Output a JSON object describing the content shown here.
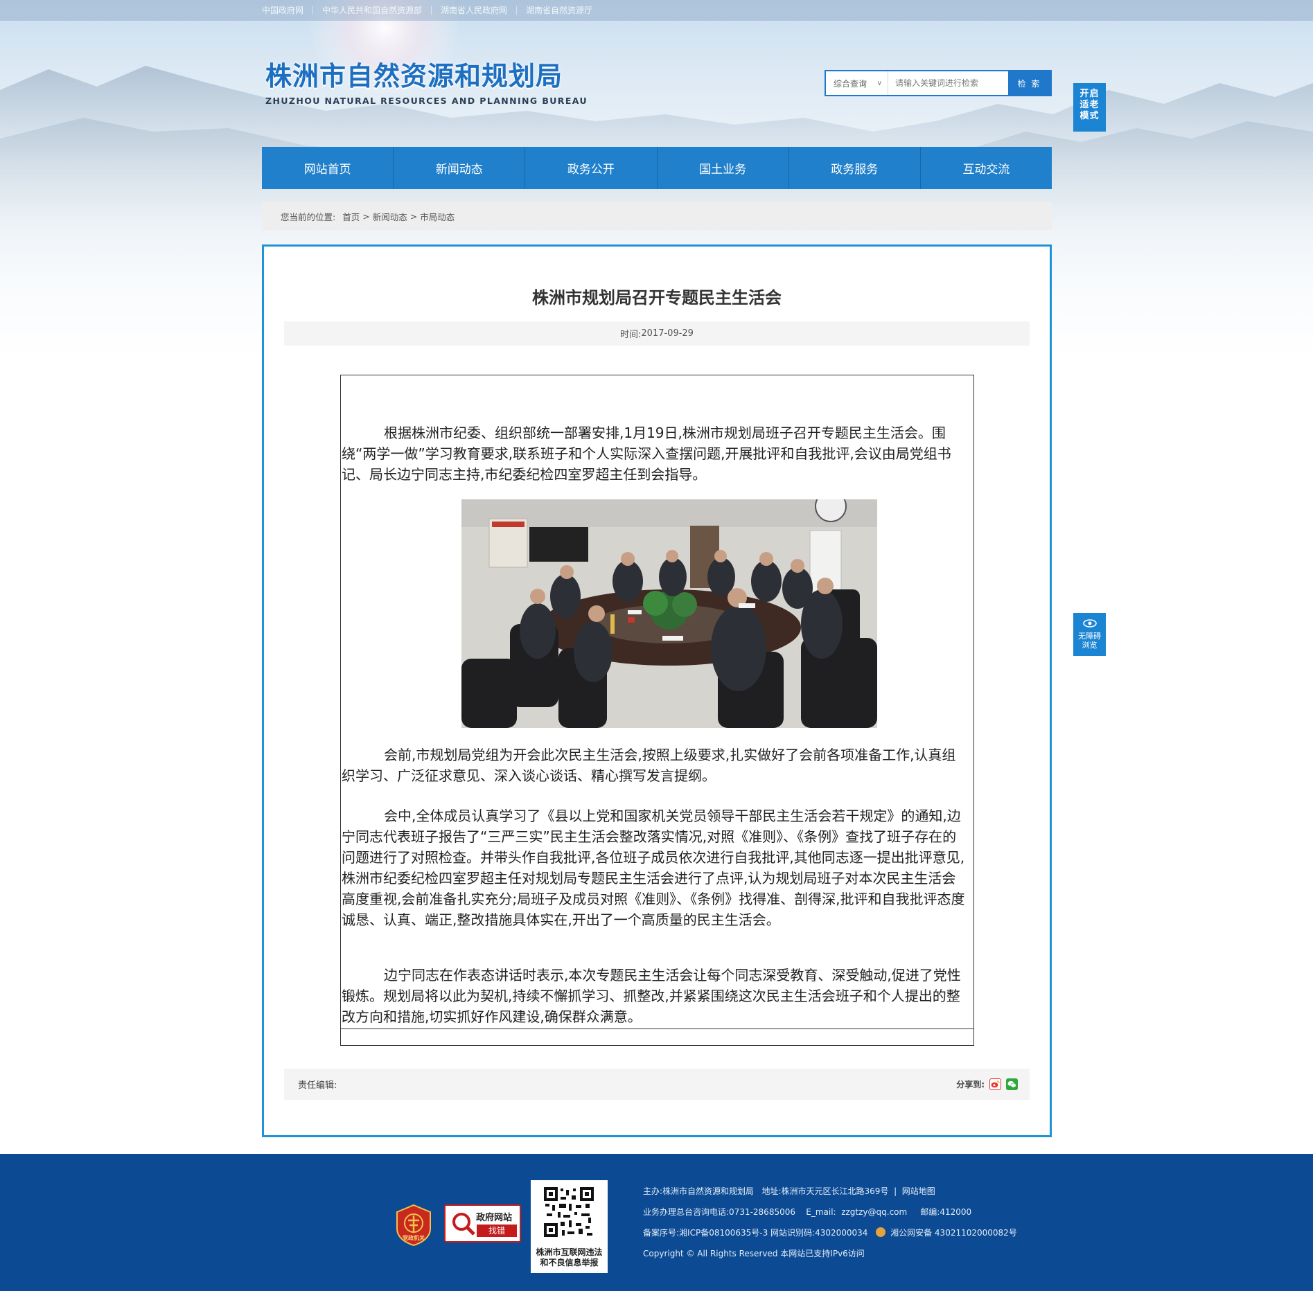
{
  "top_links": [
    "中国政府网",
    "中华人民共和国自然资源部",
    "湖南省人民政府网",
    "湖南省自然资源厅"
  ],
  "logo": {
    "cn": "株洲市自然资源和规划局",
    "en": "ZHUZHOU NATURAL RESOURCES AND PLANNING BUREAU"
  },
  "search": {
    "scope": "综合查询",
    "placeholder": "请输入关键词进行检索",
    "button": "检 索"
  },
  "elder_mode": {
    "label": "开启适老模式"
  },
  "nav": [
    "网站首页",
    "新闻动态",
    "政务公开",
    "国土业务",
    "政务服务",
    "互动交流"
  ],
  "breadcrumb": {
    "prefix": "您当前的位置:",
    "items": [
      "首页",
      "新闻动态",
      "市局动态"
    ],
    "separator": ">"
  },
  "article": {
    "title": "株洲市规划局召开专题民主生活会",
    "time_label": "时间:",
    "time": "2017-09-29",
    "paragraphs": [
      "根据株洲市纪委、组织部统一部署安排,1月19日,株洲市规划局班子召开专题民主生活会。围绕“两学一做”学习教育要求,联系班子和个人实际深入查摆问题,开展批评和自我批评,会议由局党组书记、局长边宁同志主持,市纪委纪检四室罗超主任到会指导。",
      "会前,市规划局党组为开会此次民主生活会,按照上级要求,扎实做好了会前各项准备工作,认真组织学习、广泛征求意见、深入谈心谈话、精心撰写发言提纲。",
      "会中,全体成员认真学习了《县以上党和国家机关党员领导干部民主生活会若干规定》的通知,边宁同志代表班子报告了“三严三实”民主生活会整改落实情况,对照《准则》、《条例》查找了班子存在的问题进行了对照检查。并带头作自我批评,各位班子成员依次进行自我批评,其他同志逐一提出批评意见,株洲市纪委纪检四室罗超主任对规划局专题民主生活会进行了点评,认为规划局班子对本次民主生活会高度重视,会前准备扎实充分;局班子及成员对照《准则》、《条例》找得准、剖得深,批评和自我批评态度诚恳、认真、端正,整改措施具体实在,开出了一个高质量的民主生活会。",
      "边宁同志在作表态讲话时表示,本次专题民主生活会让每个同志深受教育、深受触动,促进了党性锻炼。规划局将以此为契机,持续不懈抓学习、抓整改,并紧紧围绕这次民主生活会班子和个人提出的整改方向和措施,切实抓好作风建设,确保群众满意。"
    ],
    "editor_label": "责任编辑:",
    "share_label": "分享到:"
  },
  "accessibility": {
    "line1": "无障碍",
    "line2": "浏览"
  },
  "footer": {
    "badge_party": "党政机关",
    "badge_gov_line1": "政府网站",
    "badge_gov_line2": "找错",
    "qr_line1": "株洲市互联网违法",
    "qr_line2": "和不良信息举报",
    "line1": "主办:株洲市自然资源和规划局   地址:株洲市天元区长江北路369号  |  网站地图",
    "line2": "业务办理总台咨询电话:0731-28685006    E_mail:  zzgtzy@qq.com     邮编:412000",
    "line3_a": "备案序号:湘ICP备08100635号-3 网站识别码:4302000034",
    "line3_b": "湘公网安备 43021102000082号",
    "line4": "Copyright © All Rights Reserved 本网站已支持IPv6访问"
  },
  "colors": {
    "brand_blue": "#2180cb",
    "frame_border": "#1f93d8",
    "footer_bg": "#0c4b94"
  }
}
